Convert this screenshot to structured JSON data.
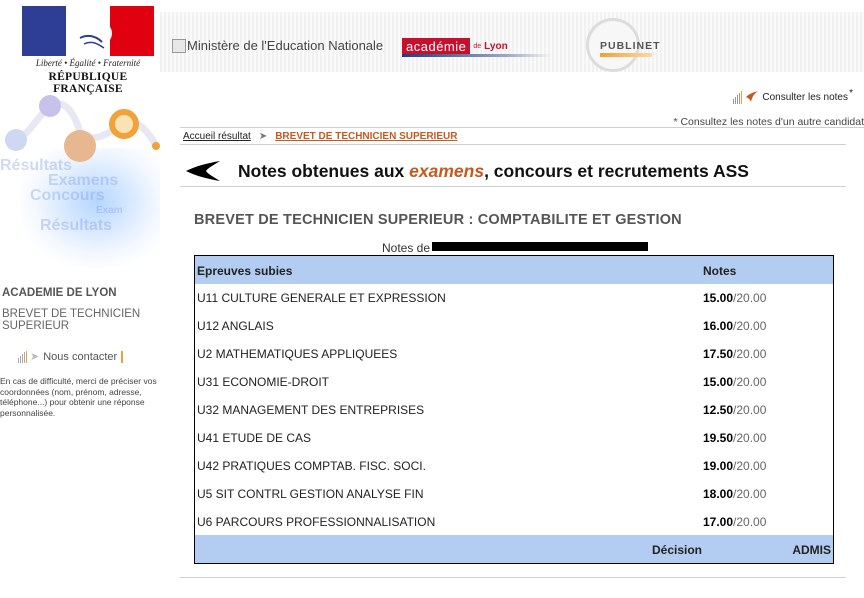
{
  "header": {
    "rf_motto": "Liberté • Égalité • Fraternité",
    "rf_name": "RÉPUBLIQUE FRANÇAISE",
    "ministere": "Ministère de l'Education Nationale",
    "academie_word": "académie",
    "academie_de": "de",
    "academie_city": "Lyon",
    "publinet": "PUBLINET",
    "brand_red": "#c8102e",
    "brand_orange": "#f1a033"
  },
  "utilities": {
    "consult_notes": "Consulter les notes",
    "consult_star": "*",
    "consult_other": "* Consultez les notes d'un autre candidat"
  },
  "breadcrumb": {
    "home": "Accueil résultat",
    "current": "BREVET DE TECHNICIEN SUPERIEUR"
  },
  "page": {
    "title_before": "Notes obtenues aux ",
    "title_em": "examens",
    "title_after": ", concours et recrutements ASS",
    "exam_heading": "BREVET DE TECHNICIEN SUPERIEUR : COMPTABILITE ET GESTION",
    "notes_de": "Notes de"
  },
  "results": {
    "header_color": "#b3ccf1",
    "col_epreuve": "Epreuves subies",
    "col_notes": "Notes",
    "rows": [
      {
        "subject": "U11 CULTURE GENERALE ET EXPRESSION",
        "note": "15.00",
        "max": "/20.00"
      },
      {
        "subject": "U12 ANGLAIS",
        "note": "16.00",
        "max": "/20.00"
      },
      {
        "subject": "U2 MATHEMATIQUES APPLIQUEES",
        "note": "17.50",
        "max": "/20.00"
      },
      {
        "subject": "U31 ECONOMIE-DROIT",
        "note": "15.00",
        "max": "/20.00"
      },
      {
        "subject": "U32 MANAGEMENT DES ENTREPRISES",
        "note": "12.50",
        "max": "/20.00"
      },
      {
        "subject": "U41 ETUDE DE CAS",
        "note": "19.50",
        "max": "/20.00"
      },
      {
        "subject": "U42 PRATIQUES COMPTAB. FISC. SOCI.",
        "note": "19.00",
        "max": "/20.00"
      },
      {
        "subject": "U5 SIT CONTRL GESTION ANALYSE FIN",
        "note": "18.00",
        "max": "/20.00"
      },
      {
        "subject": "U6 PARCOURS PROFESSIONNALISATION",
        "note": "17.00",
        "max": "/20.00"
      }
    ],
    "decision_label": "Décision",
    "decision_value": "ADMIS"
  },
  "sidebar": {
    "art_words": [
      "Résultats",
      "Examens",
      "Concours",
      "Exam",
      "Résultats"
    ],
    "academie": "ACADEMIE DE LYON",
    "exam": "BREVET DE TECHNICIEN SUPERIEUR",
    "contact": "Nous contacter",
    "help": "En cas de difficulté, merci de préciser vos coordonnées (nom, prénom, adresse, téléphone...) pour obtenir une réponse personnalisée."
  }
}
